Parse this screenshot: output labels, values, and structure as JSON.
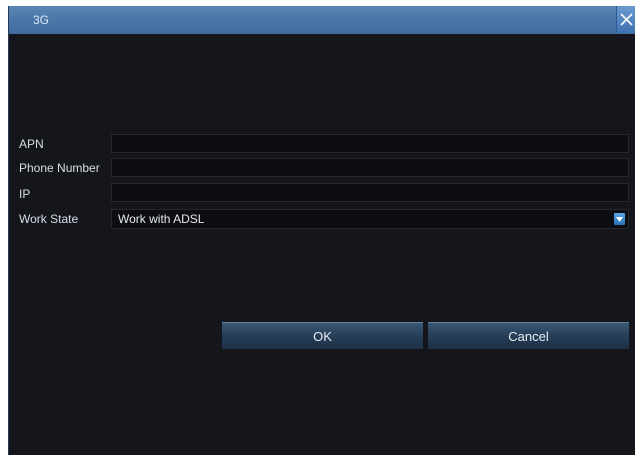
{
  "dialog": {
    "title": "3G",
    "close_icon": "close-icon"
  },
  "form": {
    "apn": {
      "label": "APN",
      "value": ""
    },
    "phone_number": {
      "label": "Phone Number",
      "value": ""
    },
    "ip": {
      "label": "IP",
      "value": ""
    },
    "work_state": {
      "label": "Work State",
      "selected": "Work with ADSL",
      "dropdown_icon": "chevron-down-icon"
    }
  },
  "buttons": {
    "ok_label": "OK",
    "cancel_label": "Cancel"
  },
  "colors": {
    "titlebar": "#4a78a8",
    "background": "#14161c",
    "field": "#0c0d10",
    "button": "#263e57"
  }
}
